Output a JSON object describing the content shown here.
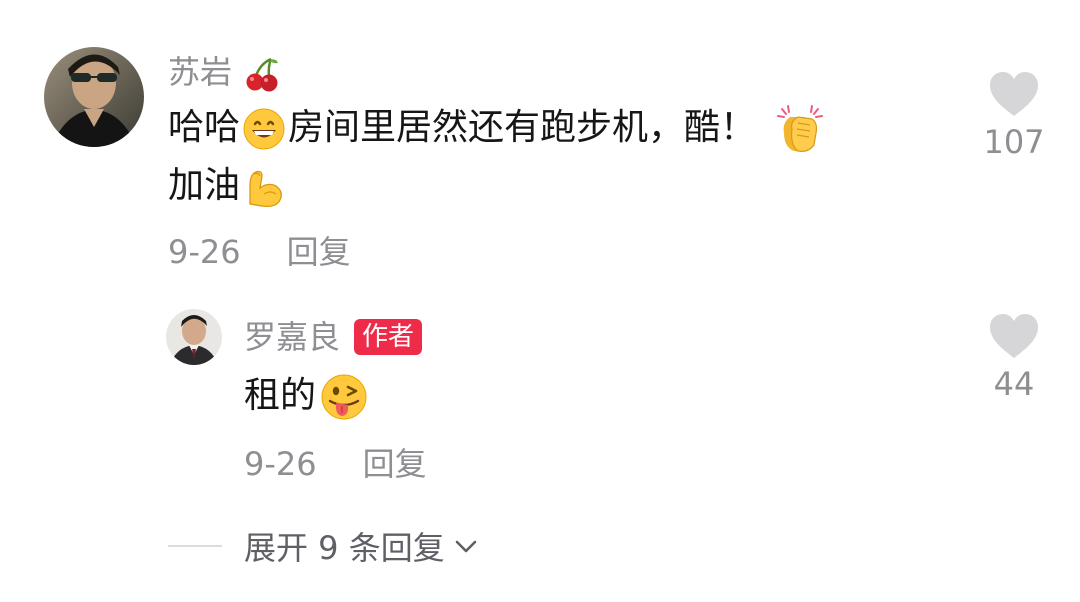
{
  "comment": {
    "author": "苏岩",
    "author_emoji": "cherries-emoji",
    "text_part1": "哈哈",
    "emoji1": "grinning-face-emoji",
    "text_part2": "房间里居然还有跑步机，酷！",
    "emoji2": "clapping-hands-emoji",
    "text_line2": "加油",
    "emoji3": "flexed-biceps-emoji",
    "date": "9-26",
    "reply_label": "回复",
    "like_count": "107"
  },
  "reply": {
    "author": "罗嘉良",
    "badge": "作者",
    "text": "租的",
    "emoji": "winking-tongue-face-emoji",
    "date": "9-26",
    "reply_label": "回复",
    "like_count": "44"
  },
  "expand_replies": {
    "label": "展开 9 条回复",
    "icon": "chevron-down-icon"
  },
  "colors": {
    "meta_gray": "#8e8e93",
    "heart_gray": "#d6d6d9",
    "badge_red": "#ee2c4a",
    "text_dark": "#161616"
  }
}
